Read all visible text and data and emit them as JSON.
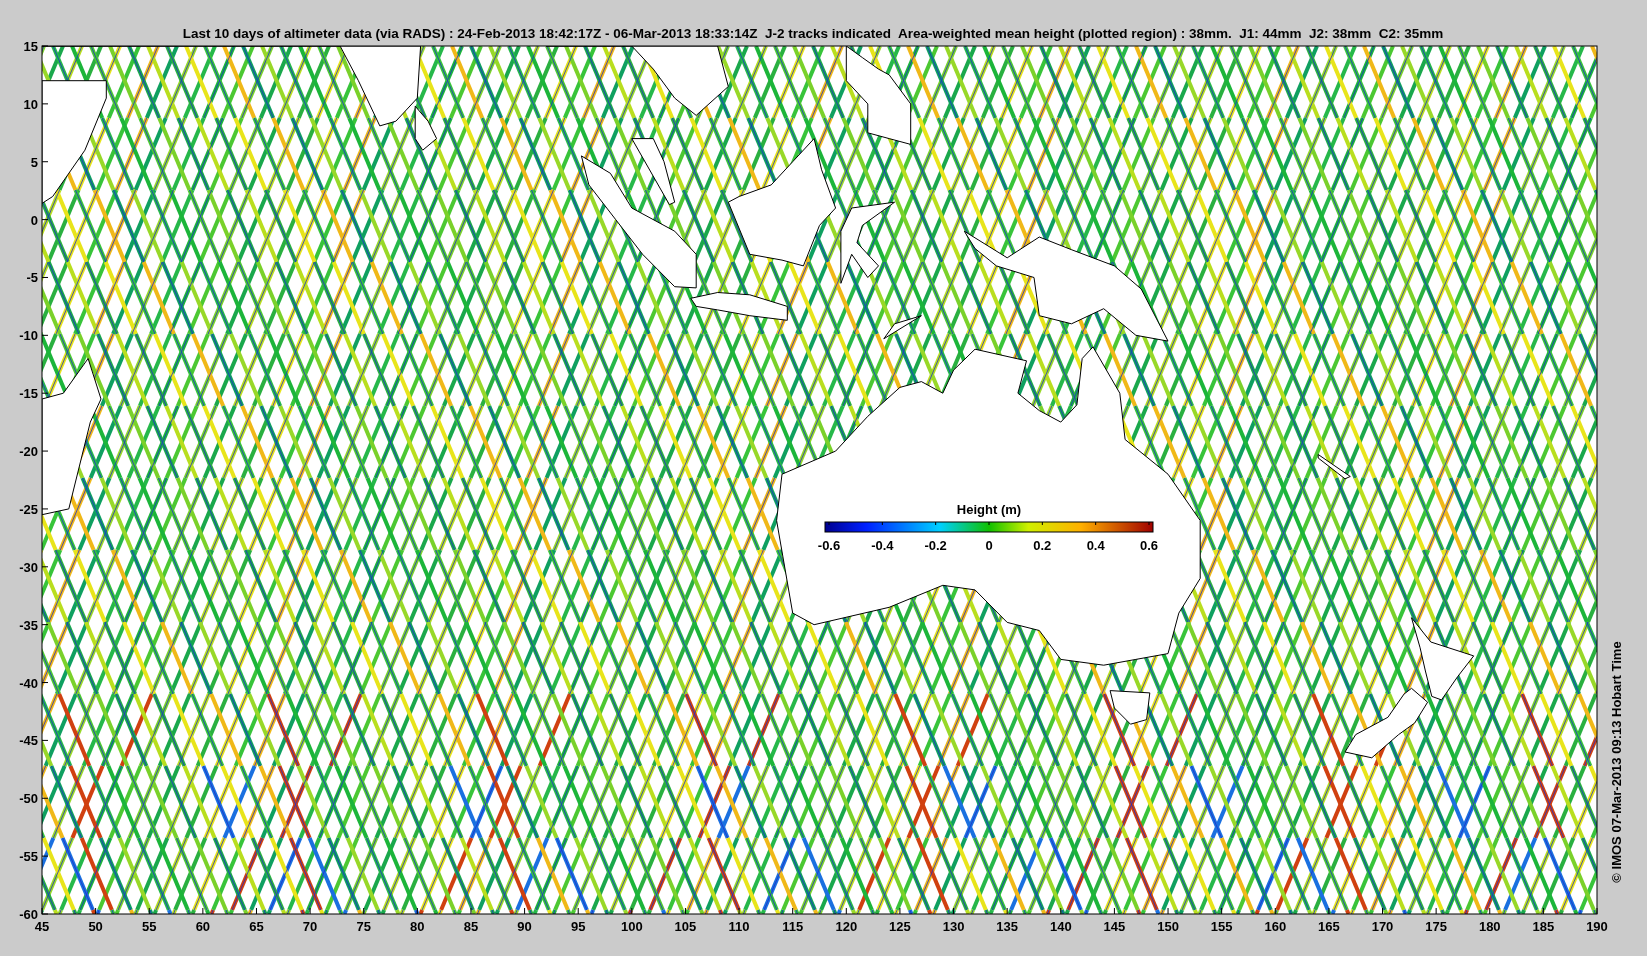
{
  "title": "Last 10 days of altimeter data (via RADS) : 24-Feb-2013 18:42:17Z - 06-Mar-2013 18:33:14Z  J-2 tracks indicated  Area-weighted mean height (plotted region) : 38mm.  J1: 44mm  J2: 38mm  C2: 35mm",
  "credit": "© IMOS 07-Mar-2013 09:13 Hobart Time",
  "y_ticks": [
    "15",
    "10",
    "5",
    "0",
    "-5",
    "-10",
    "-15",
    "-20",
    "-25",
    "-30",
    "-35",
    "-40",
    "-45",
    "-50",
    "-55",
    "-60"
  ],
  "x_ticks": [
    "45",
    "50",
    "55",
    "60",
    "65",
    "70",
    "75",
    "80",
    "85",
    "90",
    "95",
    "100",
    "105",
    "110",
    "115",
    "120",
    "125",
    "130",
    "135",
    "140",
    "145",
    "150",
    "155",
    "160",
    "165",
    "170",
    "175",
    "180",
    "185",
    "190"
  ],
  "colorbar": {
    "title": "Height (m)",
    "ticks": [
      "-0.6",
      "-0.4",
      "-0.2",
      "0",
      "0.2",
      "0.4",
      "0.6"
    ]
  }
}
